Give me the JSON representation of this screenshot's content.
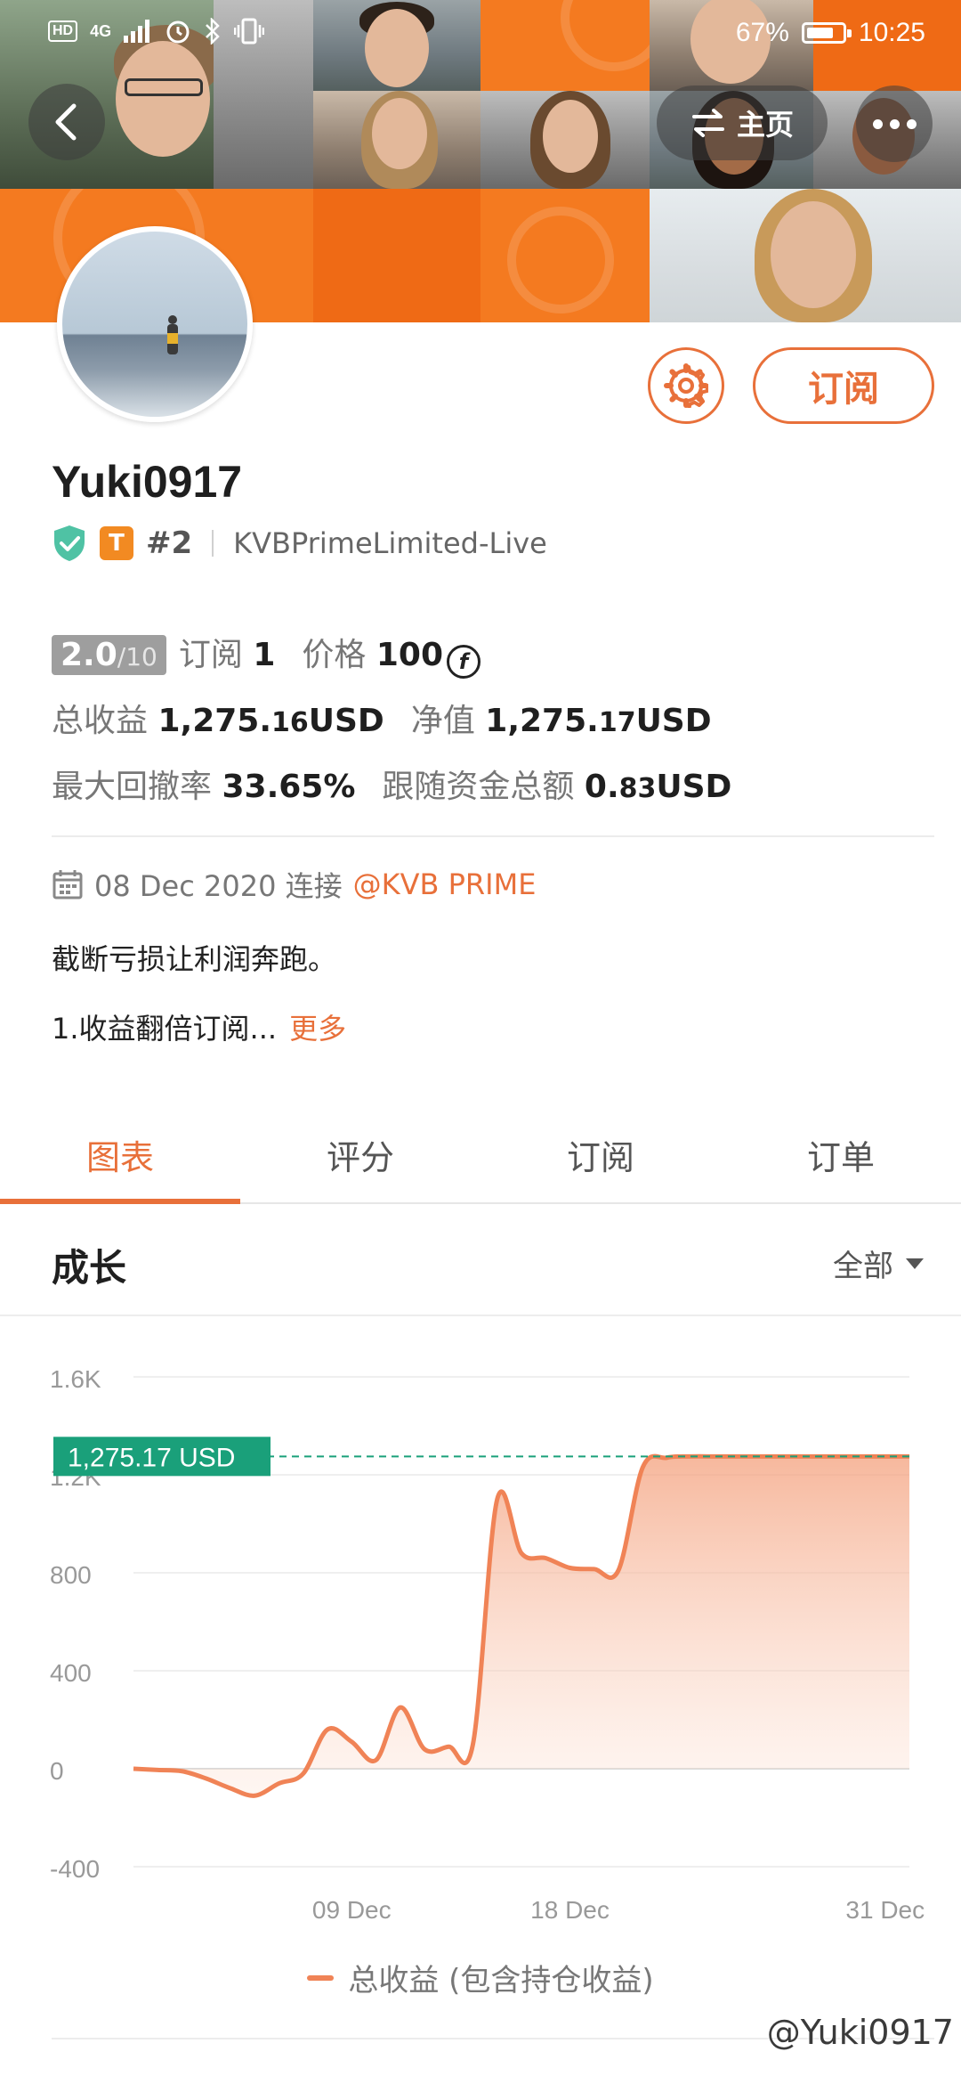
{
  "status_bar": {
    "network": "4G",
    "hd": "HD",
    "battery_text": "67%",
    "battery_level": 0.67,
    "time": "10:25"
  },
  "header": {
    "home_label": "主页"
  },
  "profile": {
    "username": "Yuki0917",
    "badge_letter": "T",
    "rank": "#2",
    "broker": "KVBPrimeLimited-Live",
    "subscribe_label": "订阅",
    "score_value": "2.0",
    "score_denominator": "/10",
    "subscribe_count_label": "订阅",
    "subscribe_count": "1",
    "price_label": "价格",
    "price_value": "100",
    "coin_glyph": "f",
    "total_profit_label": "总收益",
    "total_profit_main": "1,275.",
    "total_profit_decimals": "16",
    "total_profit_unit": " USD",
    "net_value_label": "净值",
    "net_value_main": "1,275.",
    "net_value_decimals": "17",
    "net_value_unit": " USD",
    "max_drawdown_label": "最大回撤率",
    "max_drawdown": "33.65%",
    "follow_funds_label": "跟随资金总额",
    "follow_funds_main": "0.",
    "follow_funds_decimals": "83",
    "follow_funds_unit": " USD",
    "connect_date": "08 Dec 2020 连接",
    "connect_broker": "@KVB PRIME",
    "description_line1": "截断亏损让利润奔跑。",
    "description_line2": "1.收益翻倍订阅...",
    "more_label": "更多"
  },
  "tabs": [
    {
      "label": "图表",
      "active": true
    },
    {
      "label": "评分",
      "active": false
    },
    {
      "label": "订阅",
      "active": false
    },
    {
      "label": "订单",
      "active": false
    }
  ],
  "section": {
    "title": "成长",
    "filter_label": "全部"
  },
  "chart_data": {
    "type": "area",
    "y_ticks": [
      "1.6K",
      "1.2K",
      "800",
      "400",
      "0",
      "-400"
    ],
    "y_tick_values": [
      1600,
      1200,
      800,
      400,
      0,
      -400
    ],
    "ylim": [
      -400,
      1600
    ],
    "x_ticks": [
      "09 Dec",
      "18 Dec",
      "31 Dec"
    ],
    "x_tick_index": [
      9,
      18,
      31
    ],
    "xlim": [
      0,
      32
    ],
    "current_value_label": "1,275.17 USD",
    "current_value": 1275.17,
    "series": [
      {
        "name": "总收益 (包含持仓收益)",
        "color": "#f08356",
        "x": [
          0,
          1,
          2,
          3,
          4,
          5,
          6,
          7,
          8,
          9,
          10,
          11,
          12,
          13,
          14,
          15,
          16,
          17,
          18,
          19,
          20,
          21,
          22,
          23,
          24,
          25,
          26,
          27,
          28,
          29,
          30,
          31,
          32
        ],
        "values": [
          0,
          -5,
          -10,
          -40,
          -80,
          -110,
          -60,
          -20,
          160,
          110,
          35,
          250,
          80,
          90,
          100,
          1100,
          880,
          860,
          820,
          815,
          810,
          1230,
          1270,
          1275,
          1275,
          1275,
          1275,
          1275,
          1275,
          1275,
          1275,
          1275,
          1275
        ]
      }
    ]
  },
  "watermark": "@Yuki0917"
}
